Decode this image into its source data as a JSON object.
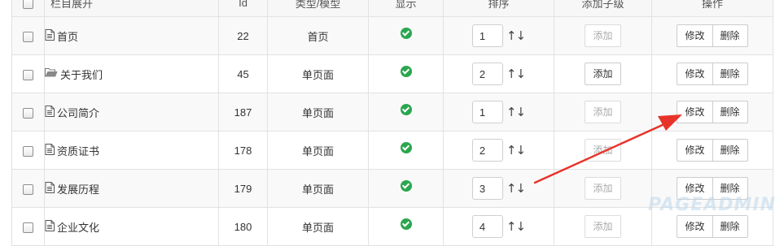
{
  "header": {
    "col_name": "栏目展开",
    "col_id": "Id",
    "col_type": "类型/模型",
    "col_show": "显示",
    "col_sort": "排序",
    "col_add_child": "添加子级",
    "col_actions": "操作"
  },
  "rows": [
    {
      "name": "首页",
      "icon": "page-icon",
      "id": "22",
      "type": "首页",
      "sort": "1",
      "add_label": "添加",
      "add_enabled": false,
      "edit_label": "修改",
      "delete_label": "删除"
    },
    {
      "name": "关于我们",
      "icon": "folder-open-icon",
      "id": "45",
      "type": "单页面",
      "sort": "2",
      "add_label": "添加",
      "add_enabled": true,
      "edit_label": "修改",
      "delete_label": "删除"
    },
    {
      "name": "公司简介",
      "icon": "page-icon",
      "id": "187",
      "type": "单页面",
      "sort": "1",
      "add_label": "添加",
      "add_enabled": false,
      "edit_label": "修改",
      "delete_label": "删除"
    },
    {
      "name": "资质证书",
      "icon": "page-icon",
      "id": "178",
      "type": "单页面",
      "sort": "2",
      "add_label": "添加",
      "add_enabled": false,
      "edit_label": "修改",
      "delete_label": "删除"
    },
    {
      "name": "发展历程",
      "icon": "page-icon",
      "id": "179",
      "type": "单页面",
      "sort": "3",
      "add_label": "添加",
      "add_enabled": false,
      "edit_label": "修改",
      "delete_label": "删除"
    },
    {
      "name": "企业文化",
      "icon": "page-icon",
      "id": "180",
      "type": "单页面",
      "sort": "4",
      "add_label": "添加",
      "add_enabled": false,
      "edit_label": "修改",
      "delete_label": "删除"
    }
  ],
  "sort_arrows": "↑↓",
  "watermark": "PAGEADMIN",
  "colors": {
    "check": "#2aa64f",
    "annotation_arrow": "#e8332a"
  }
}
